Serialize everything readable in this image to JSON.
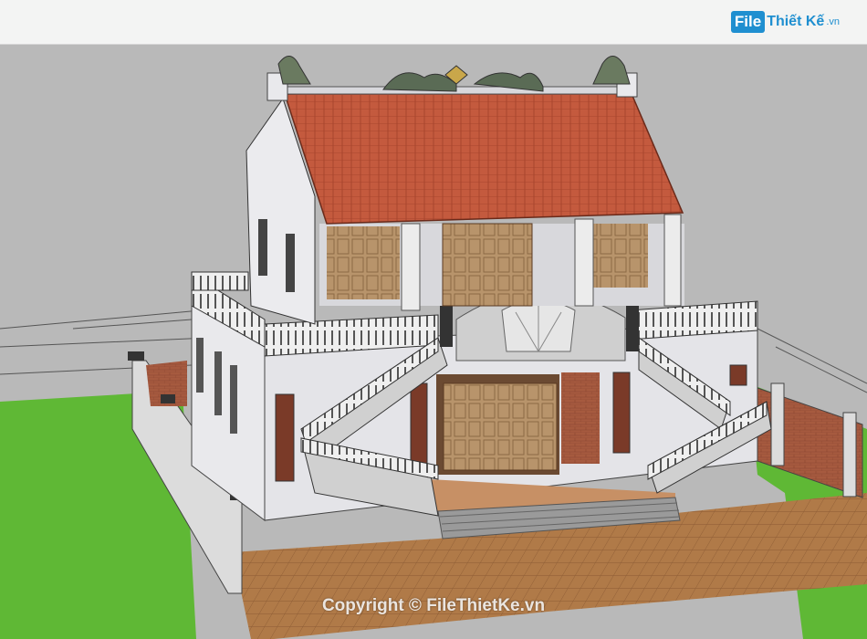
{
  "header": {
    "logo_box": "File",
    "logo_rest": "Thiết Kế",
    "logo_dot": ".vn"
  },
  "watermark": "Copyright © FileThietKe.vn",
  "colors": {
    "sky": "#b9b9b9",
    "grass": "#5fb835",
    "brick_paving": "#b07a48",
    "roof": "#c45a3e",
    "wall": "#e9e9ec",
    "brick_wall": "#a65a3f",
    "wood": "#b8946b"
  },
  "icons": [
    "dragon-ornament-icon",
    "fan-relief-icon"
  ]
}
